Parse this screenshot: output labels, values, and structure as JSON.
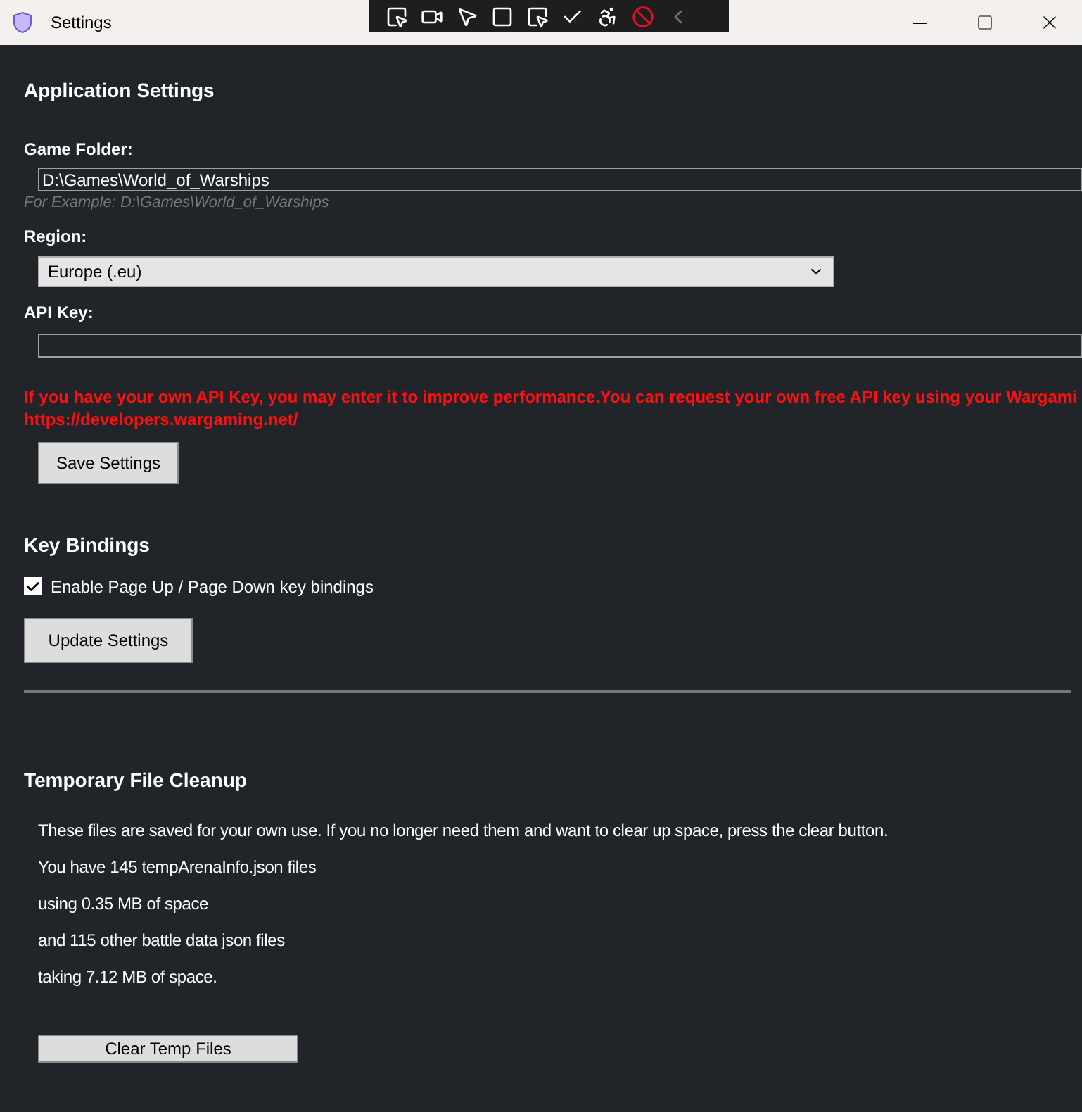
{
  "window": {
    "title": "Settings"
  },
  "application_settings": {
    "heading": "Application Settings",
    "game_folder": {
      "label": "Game Folder:",
      "value": "D:\\Games\\World_of_Warships",
      "hint": "For Example: D:\\Games\\World_of_Warships"
    },
    "region": {
      "label": "Region:",
      "value": "Europe (.eu)"
    },
    "api_key": {
      "label": "API Key:"
    },
    "notice": [
      "If you have your own API Key, you may enter it to improve performance.You can request your own free API key using your Wargami",
      "https://developers.wargaming.net/"
    ],
    "button": "Save Settings"
  },
  "key_bindings": {
    "heading": "Key Bindings",
    "option": {
      "label": "Enable Page Up / Page Down key bindings",
      "checked": true
    },
    "button": "Update Settings"
  },
  "cleanup": {
    "heading": "Temporary File Cleanup",
    "lines": [
      "These files are saved for your own use. If you no longer need them and want to clear up space, press the clear button.",
      "You have 145 tempArenaInfo.json files",
      "using 0.35 MB of space",
      "and 115 other battle data json files",
      "taking 7.12 MB of space."
    ],
    "button": "Clear Temp Files"
  }
}
